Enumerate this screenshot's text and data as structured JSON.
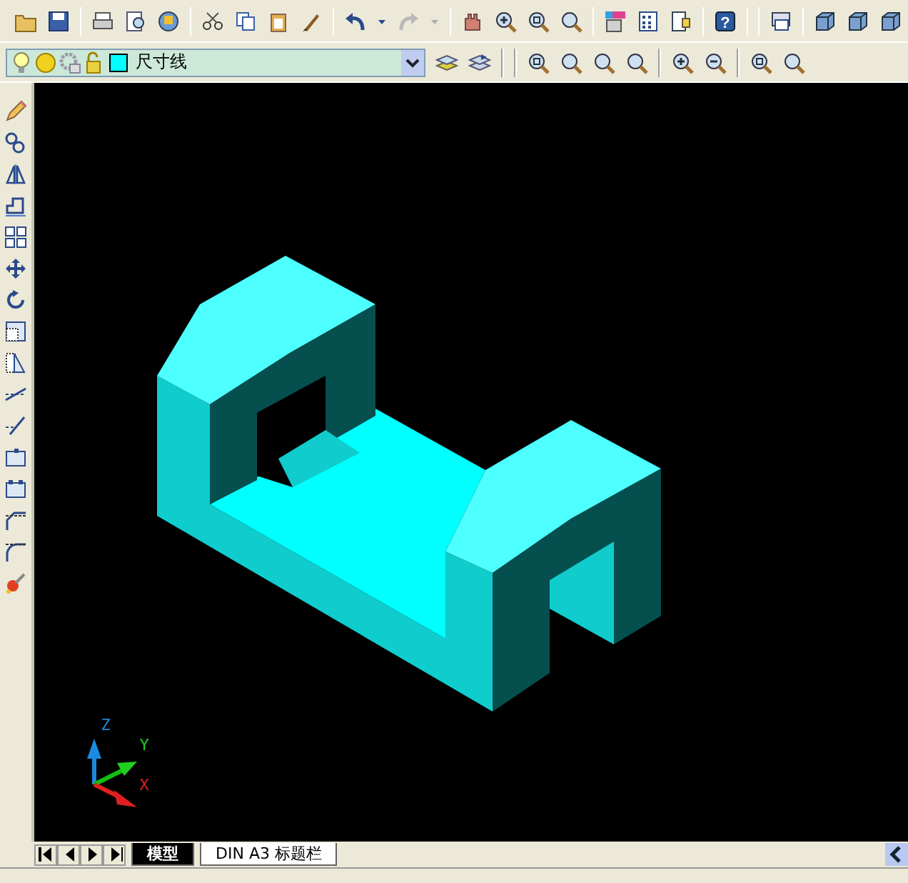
{
  "toolbar": {
    "help_glyph": "?"
  },
  "layer_control": {
    "value": "尺寸线"
  },
  "ucs_icon": {
    "axes": [
      "Z",
      "Y",
      "X"
    ]
  },
  "layout_tabs": [
    {
      "label": "模型",
      "selected": true
    },
    {
      "label": "DIN A3 标题栏",
      "selected": false
    }
  ]
}
